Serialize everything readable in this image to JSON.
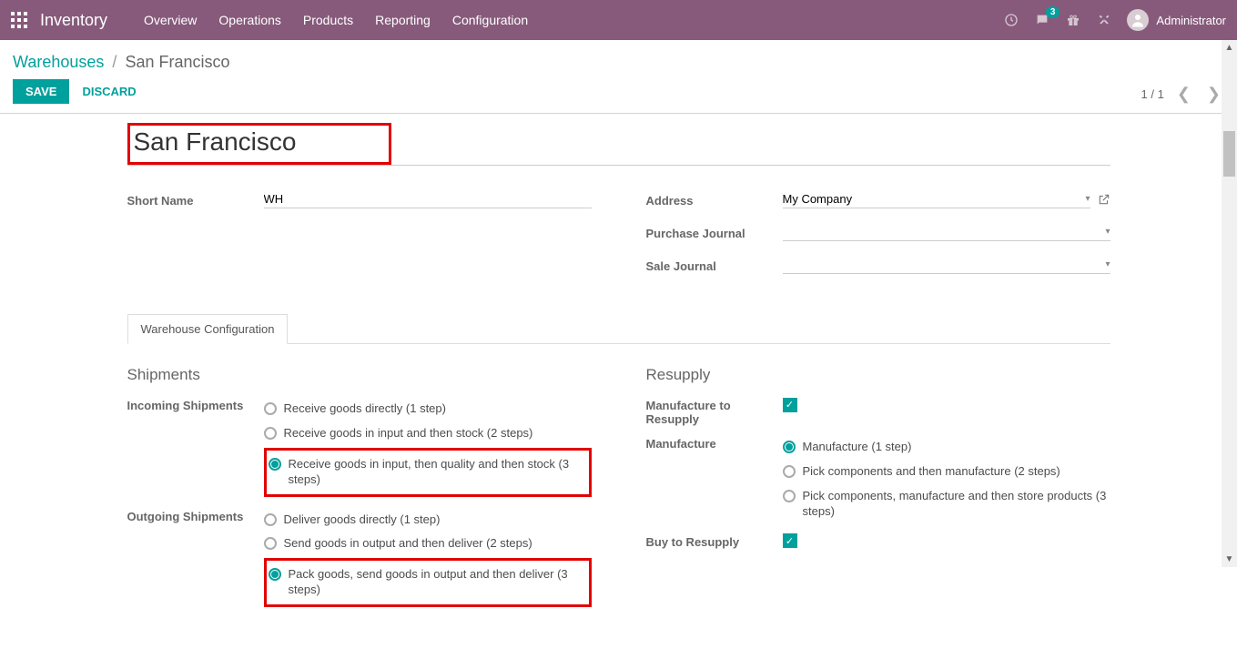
{
  "topbar": {
    "brand": "Inventory",
    "nav": [
      "Overview",
      "Operations",
      "Products",
      "Reporting",
      "Configuration"
    ],
    "msg_count": "3",
    "user": "Administrator"
  },
  "breadcrumb": {
    "root": "Warehouses",
    "current": "San Francisco"
  },
  "actions": {
    "save": "Save",
    "discard": "Discard"
  },
  "pager": {
    "text": "1 / 1"
  },
  "form": {
    "name": "San Francisco",
    "short_name_label": "Short Name",
    "short_name": "WH",
    "address_label": "Address",
    "address": "My Company",
    "purchase_journal_label": "Purchase Journal",
    "purchase_journal": "",
    "sale_journal_label": "Sale Journal",
    "sale_journal": ""
  },
  "tab": "Warehouse Configuration",
  "sections": {
    "shipments": {
      "title": "Shipments",
      "incoming_label": "Incoming Shipments",
      "incoming": {
        "opt1": "Receive goods directly (1 step)",
        "opt2": "Receive goods in input and then stock (2 steps)",
        "opt3": "Receive goods in input, then quality and then stock (3 steps)",
        "selected": "opt3"
      },
      "outgoing_label": "Outgoing Shipments",
      "outgoing": {
        "opt1": "Deliver goods directly (1 step)",
        "opt2": "Send goods in output and then deliver (2 steps)",
        "opt3": "Pack goods, send goods in output and then deliver (3 steps)",
        "selected": "opt3"
      }
    },
    "resupply": {
      "title": "Resupply",
      "manuf_resupply_label": "Manufacture to Resupply",
      "manuf_resupply": true,
      "manuf_label": "Manufacture",
      "manuf": {
        "opt1": "Manufacture (1 step)",
        "opt2": "Pick components and then manufacture (2 steps)",
        "opt3": "Pick components, manufacture and then store products (3 steps)",
        "selected": "opt1"
      },
      "buy_resupply_label": "Buy to Resupply",
      "buy_resupply": true
    }
  }
}
